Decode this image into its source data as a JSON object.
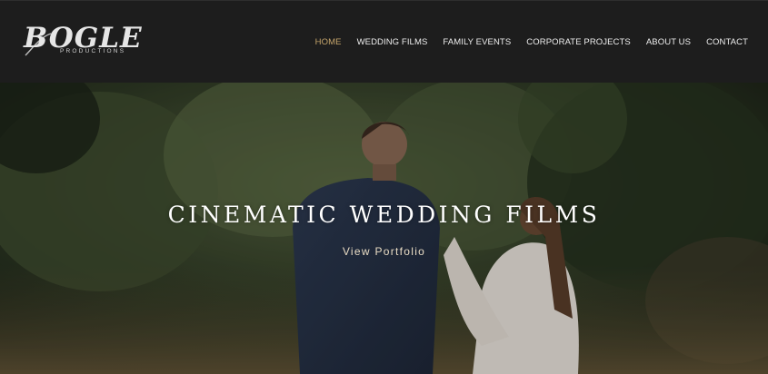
{
  "logo": {
    "main": "BOGLE",
    "sub": "PRODUCTIONS"
  },
  "nav": {
    "items": [
      {
        "label": "HOME",
        "active": true
      },
      {
        "label": "WEDDING FILMS",
        "active": false
      },
      {
        "label": "FAMILY EVENTS",
        "active": false
      },
      {
        "label": "CORPORATE PROJECTS",
        "active": false
      },
      {
        "label": "ABOUT US",
        "active": false
      },
      {
        "label": "CONTACT",
        "active": false
      }
    ]
  },
  "hero": {
    "title": "CINEMATIC WEDDING FILMS",
    "link_label": "View Portfolio"
  },
  "colors": {
    "header_bg": "#1d1d1d",
    "nav_active": "#c5a56b",
    "nav_text": "#ededed"
  }
}
